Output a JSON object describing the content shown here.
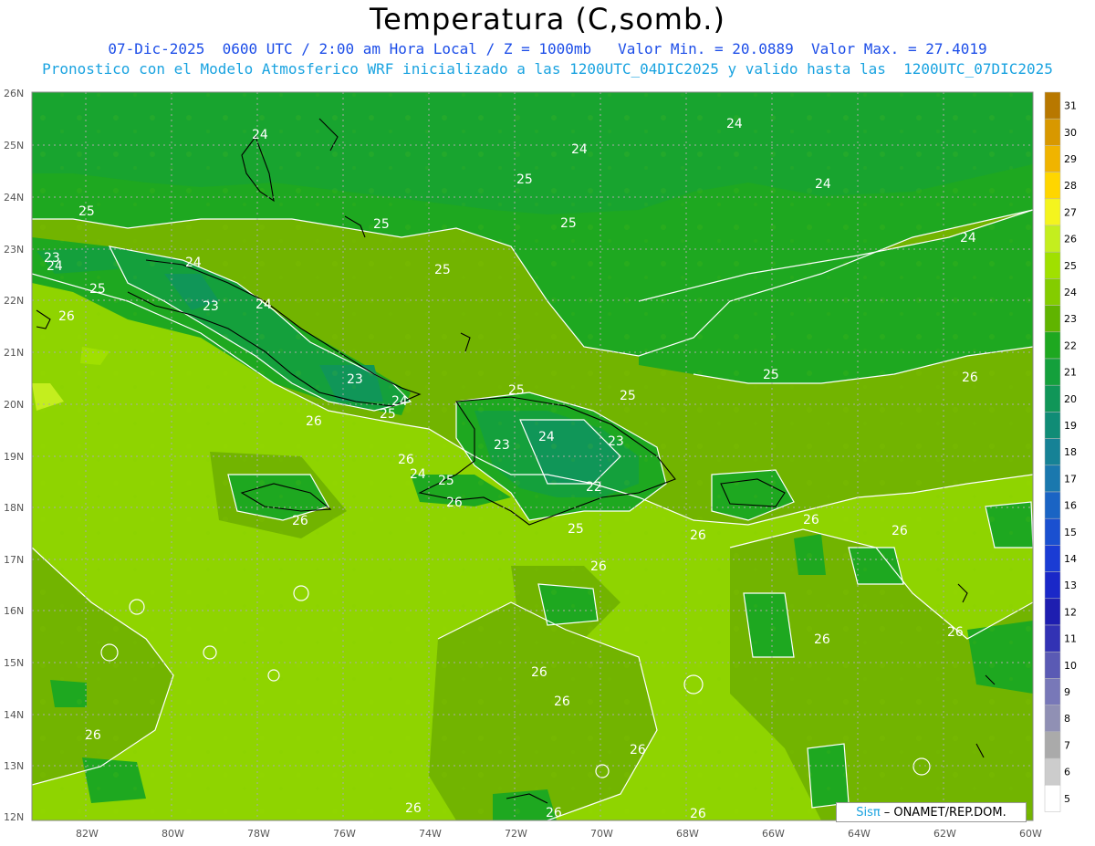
{
  "header": {
    "title": "Temperatura (C,somb.)",
    "line1": "07-Dic-2025  0600 UTC / 2:00 am Hora Local / Z = 1000mb   Valor Min. = 20.0889  Valor Max. = 27.4019",
    "line2": "Pronostico con el Modelo Atmosferico WRF inicializado a las 1200UTC_04DIC2025 y valido hasta las  1200UTC_07DIC2025"
  },
  "axes": {
    "lat_labels": [
      "26N",
      "25N",
      "24N",
      "23N",
      "22N",
      "21N",
      "20N",
      "19N",
      "18N",
      "17N",
      "16N",
      "15N",
      "14N",
      "13N",
      "12N"
    ],
    "lon_labels": [
      "82W",
      "80W",
      "78W",
      "76W",
      "74W",
      "72W",
      "70W",
      "68W",
      "66W",
      "64W",
      "62W",
      "60W"
    ]
  },
  "colorbar": {
    "levels": [
      "31",
      "30",
      "29",
      "28",
      "27",
      "26",
      "25",
      "24",
      "23",
      "22",
      "21",
      "20",
      "19",
      "18",
      "17",
      "16",
      "15",
      "14",
      "13",
      "12",
      "11",
      "10",
      "9",
      "8",
      "7",
      "6",
      "5"
    ],
    "colors": [
      "#b87800",
      "#d89800",
      "#f0b400",
      "#ffd600",
      "#f4f41e",
      "#c4ee1e",
      "#a0e000",
      "#84cc00",
      "#60b400",
      "#1ea820",
      "#14a03c",
      "#109658",
      "#108c76",
      "#168296",
      "#1a78ae",
      "#1a64c4",
      "#1a50d0",
      "#1a3cd4",
      "#1a28c8",
      "#1e1eb0",
      "#3232b4",
      "#5a5ab4",
      "#7878b8",
      "#9090b4",
      "#aaaaaa",
      "#cccccc",
      "#ffffff"
    ]
  },
  "contour_labels": [
    {
      "t": "24"
    },
    {
      "t": "24"
    },
    {
      "t": "24"
    },
    {
      "t": "24"
    },
    {
      "t": "24"
    },
    {
      "t": "25"
    },
    {
      "t": "25"
    },
    {
      "t": "25"
    },
    {
      "t": "25"
    },
    {
      "t": "23"
    },
    {
      "t": "24"
    },
    {
      "t": "25"
    },
    {
      "t": "24"
    },
    {
      "t": "23"
    },
    {
      "t": "24"
    },
    {
      "t": "26"
    },
    {
      "t": "25"
    },
    {
      "t": "23"
    },
    {
      "t": "24"
    },
    {
      "t": "25"
    },
    {
      "t": "26"
    },
    {
      "t": "25"
    },
    {
      "t": "25"
    },
    {
      "t": "25"
    },
    {
      "t": "23"
    },
    {
      "t": "24"
    },
    {
      "t": "23"
    },
    {
      "t": "26"
    },
    {
      "t": "24"
    },
    {
      "t": "25"
    },
    {
      "t": "26"
    },
    {
      "t": "22"
    },
    {
      "t": "26"
    },
    {
      "t": "25"
    },
    {
      "t": "26"
    },
    {
      "t": "26"
    },
    {
      "t": "26"
    },
    {
      "t": "26"
    },
    {
      "t": "26"
    },
    {
      "t": "26"
    },
    {
      "t": "26"
    },
    {
      "t": "26"
    },
    {
      "t": "26"
    },
    {
      "t": "26"
    },
    {
      "t": "26"
    },
    {
      "t": "26"
    },
    {
      "t": "26"
    },
    {
      "t": "26"
    }
  ],
  "credit": {
    "brand": "Sisπ",
    "org": "– ONAMET/REP.DOM."
  }
}
